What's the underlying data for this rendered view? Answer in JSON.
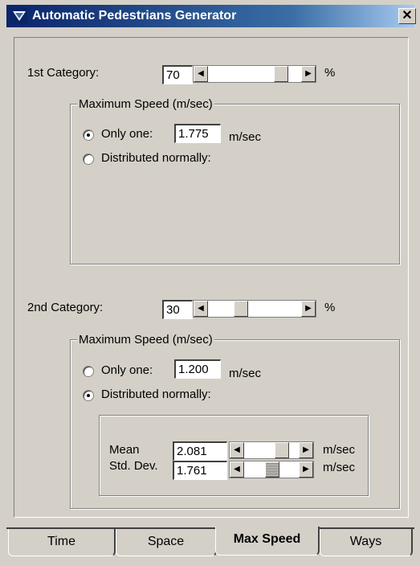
{
  "window": {
    "title": "Automatic Pedestrians Generator",
    "close_label": "✕",
    "accent": "#0a246a",
    "face": "#d4d0c8"
  },
  "cat1": {
    "label": "1st Category:",
    "value": "70",
    "unit": "%",
    "group_title": "Maximum Speed (m/sec)",
    "only_one_label": "Only one:",
    "only_one_value": "1.775",
    "only_one_unit": "m/sec",
    "distributed_label": "Distributed normally:",
    "selected": "only_one"
  },
  "cat2": {
    "label": "2nd Category:",
    "value": "30",
    "unit": "%",
    "group_title": "Maximum Speed (m/sec)",
    "only_one_label": "Only one:",
    "only_one_value": "1.200",
    "only_one_unit": "m/sec",
    "distributed_label": "Distributed normally:",
    "selected": "distributed",
    "mean_label": "Mean",
    "mean_value": "2.081",
    "mean_unit": "m/sec",
    "std_label": "Std. Dev.",
    "std_value": "1.761",
    "std_unit": "m/sec"
  },
  "tabs": [
    "Time",
    "Space",
    "Max Speed",
    "Ways"
  ],
  "active_tab": "Max Speed",
  "icons": {
    "scroll_left": "◀",
    "scroll_right": "▶"
  }
}
